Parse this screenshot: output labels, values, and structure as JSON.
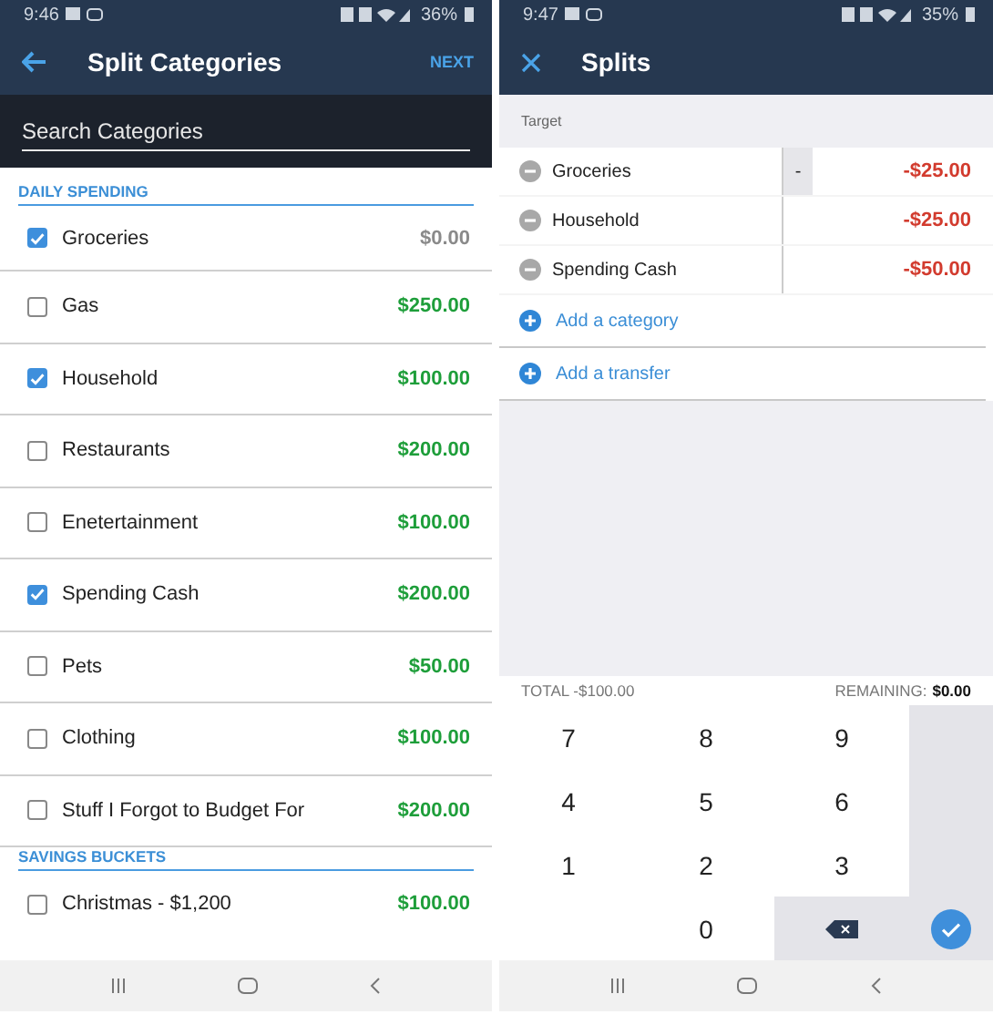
{
  "left": {
    "status": {
      "time": "9:46",
      "battery": "36%"
    },
    "title": "Split Categories",
    "action": "NEXT",
    "search": {
      "placeholder": "Search Categories"
    },
    "sections": [
      {
        "heading": "DAILY SPENDING",
        "items": [
          {
            "name": "Groceries",
            "amount": "$0.00",
            "checked": true,
            "color": "#8a8a8a"
          },
          {
            "name": "Gas",
            "amount": "$250.00",
            "checked": false,
            "color": "#1e9e3a"
          },
          {
            "name": "Household",
            "amount": "$100.00",
            "checked": true,
            "color": "#1e9e3a"
          },
          {
            "name": "Restaurants",
            "amount": "$200.00",
            "checked": false,
            "color": "#1e9e3a"
          },
          {
            "name": "Enetertainment",
            "amount": "$100.00",
            "checked": false,
            "color": "#1e9e3a"
          },
          {
            "name": "Spending Cash",
            "amount": "$200.00",
            "checked": true,
            "color": "#1e9e3a"
          },
          {
            "name": "Pets",
            "amount": "$50.00",
            "checked": false,
            "color": "#1e9e3a"
          },
          {
            "name": "Clothing",
            "amount": "$100.00",
            "checked": false,
            "color": "#1e9e3a"
          },
          {
            "name": "Stuff I Forgot to Budget For",
            "amount": "$200.00",
            "checked": false,
            "color": "#1e9e3a"
          }
        ]
      },
      {
        "heading": "SAVINGS BUCKETS",
        "items": [
          {
            "name": "Christmas - $1,200",
            "amount": "$100.00",
            "checked": false,
            "color": "#1e9e3a"
          }
        ]
      }
    ]
  },
  "right": {
    "status": {
      "time": "9:47",
      "battery": "35%"
    },
    "title": "Splits",
    "target_label": "Target",
    "splits": [
      {
        "name": "Groceries",
        "amount": "-$25.00",
        "input_prefix": "-"
      },
      {
        "name": "Household",
        "amount": "-$25.00"
      },
      {
        "name": "Spending Cash",
        "amount": "-$50.00"
      }
    ],
    "add_links": [
      "Add a category",
      "Add a transfer"
    ],
    "total": "TOTAL -$100.00",
    "remaining_label": "REMAINING:",
    "remaining": "$0.00",
    "keys": [
      {
        "label": "7",
        "kind": "digit"
      },
      {
        "label": "8",
        "kind": "digit"
      },
      {
        "label": "9",
        "kind": "digit"
      },
      {
        "kind": "blank"
      },
      {
        "label": "4",
        "kind": "digit"
      },
      {
        "label": "5",
        "kind": "digit"
      },
      {
        "label": "6",
        "kind": "digit"
      },
      {
        "kind": "blank"
      },
      {
        "label": "1",
        "kind": "digit"
      },
      {
        "label": "2",
        "kind": "digit"
      },
      {
        "label": "3",
        "kind": "digit"
      },
      {
        "kind": "blank"
      },
      {
        "kind": "empty"
      },
      {
        "label": "0",
        "kind": "digit"
      },
      {
        "kind": "backspace"
      },
      {
        "kind": "confirm"
      }
    ]
  }
}
